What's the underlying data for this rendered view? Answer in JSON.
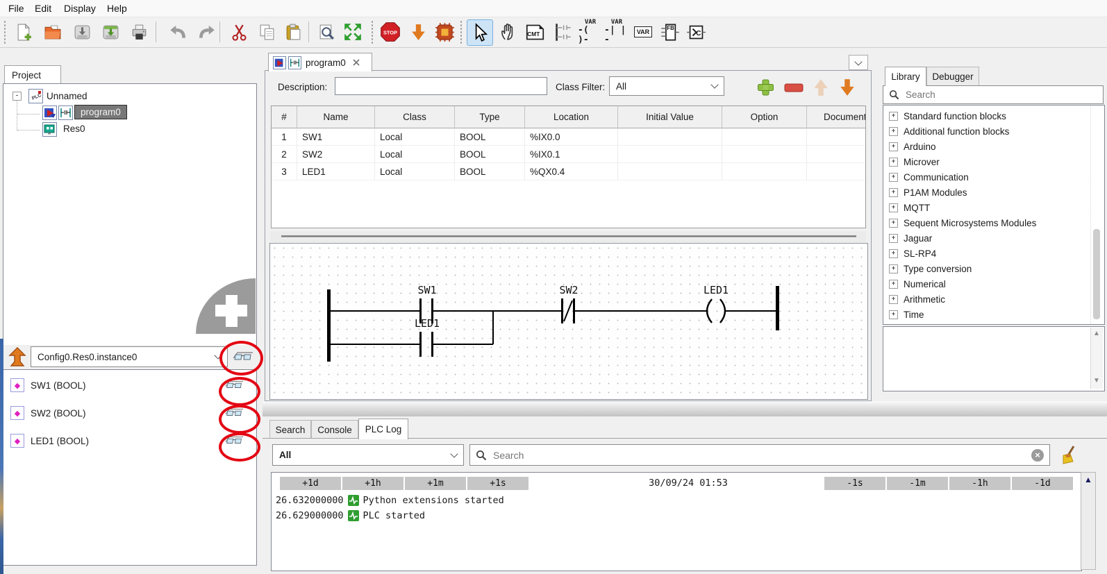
{
  "menu": {
    "items": [
      "File",
      "Edit",
      "Display",
      "Help"
    ]
  },
  "toolbar": {
    "icons": [
      "new",
      "open",
      "save",
      "save-as",
      "print",
      "undo",
      "redo",
      "cut",
      "copy",
      "paste",
      "search",
      "fit-page",
      "stop",
      "transfer",
      "build-run",
      "select",
      "motion",
      "comment",
      "power-rail",
      "coil",
      "contact",
      "variable",
      "function-block",
      "code-block"
    ],
    "icon_labels": {
      "stop": "STOP",
      "cmt": "CMT",
      "var": "VAR",
      "fb": "FB",
      "code": "C",
      "coil_glyph": "( )",
      "contact_glyph": "| |"
    }
  },
  "project_panel": {
    "tab_label": "Project",
    "root_label": "Unnamed",
    "program_label": "program0",
    "resource_label": "Res0"
  },
  "debug_panel": {
    "instance_path": "Config0.Res0.instance0",
    "variables": [
      {
        "label": "SW1 (BOOL)"
      },
      {
        "label": "SW2 (BOOL)"
      },
      {
        "label": "LED1 (BOOL)"
      }
    ]
  },
  "editor": {
    "tab_label": "program0",
    "description_label": "Description:",
    "description_value": "",
    "class_filter_label": "Class Filter:",
    "class_filter_value": "All",
    "table": {
      "headers": [
        "#",
        "Name",
        "Class",
        "Type",
        "Location",
        "Initial Value",
        "Option",
        "Documentation"
      ],
      "rows": [
        [
          "1",
          "SW1",
          "Local",
          "BOOL",
          "%IX0.0",
          "",
          "",
          ""
        ],
        [
          "2",
          "SW2",
          "Local",
          "BOOL",
          "%IX0.1",
          "",
          "",
          ""
        ],
        [
          "3",
          "LED1",
          "Local",
          "BOOL",
          "%QX0.4",
          "",
          "",
          ""
        ]
      ]
    },
    "ladder": {
      "contact1": "SW1",
      "contact_parallel": "LED1",
      "contact2": "SW2",
      "coil": "LED1"
    }
  },
  "library_panel": {
    "tabs": [
      "Library",
      "Debugger"
    ],
    "search_placeholder": "Search",
    "items": [
      "Standard function blocks",
      "Additional function blocks",
      "Arduino",
      "Microver",
      "Communication",
      "P1AM Modules",
      "MQTT",
      "Sequent Microsystems Modules",
      "Jaguar",
      "SL-RP4",
      "Type conversion",
      "Numerical",
      "Arithmetic",
      "Time"
    ]
  },
  "bottom_panel": {
    "tabs": [
      "Search",
      "Console",
      "PLC Log"
    ],
    "filter_value": "All",
    "search_placeholder": "Search",
    "log": {
      "plus_buttons": [
        "+1d",
        "+1h",
        "+1m",
        "+1s"
      ],
      "datetime": "30/09/24 01:53",
      "minus_buttons": [
        "-1s",
        "-1m",
        "-1h",
        "-1d"
      ],
      "entries": [
        {
          "time": "26.632000000",
          "message": "Python extensions started"
        },
        {
          "time": "26.629000000",
          "message": "PLC started"
        }
      ]
    }
  }
}
